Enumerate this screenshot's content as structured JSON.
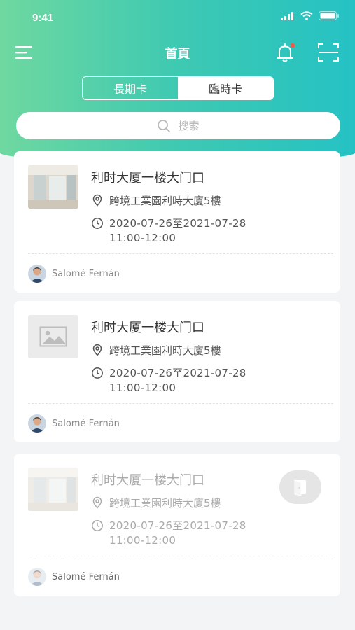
{
  "status": {
    "time": "9:41"
  },
  "nav": {
    "title": "首頁"
  },
  "tabs": [
    {
      "label": "長期卡",
      "active": false
    },
    {
      "label": "臨時卡",
      "active": true
    }
  ],
  "search": {
    "placeholder": "搜索"
  },
  "cards": [
    {
      "title": "利时大厦一楼大门口",
      "location": "跨境工業園利時大廈5樓",
      "date_range": "2020-07-26至2021-07-28",
      "time_range": "11:00-12:00",
      "user": "Salomé Fernán",
      "image": "office-photo",
      "state": "normal"
    },
    {
      "title": "利时大厦一楼大门口",
      "location": "跨境工業園利時大廈5樓",
      "date_range": "2020-07-26至2021-07-28",
      "time_range": "11:00-12:00",
      "user": "Salomé Fernán",
      "image": "image-placeholder",
      "state": "normal"
    },
    {
      "title": "利时大厦一楼大门口",
      "location": "跨境工業園利時大廈5樓",
      "date_range": "2020-07-26至2021-07-28",
      "time_range": "11:00-12:00",
      "user": "Salomé Fernán",
      "image": "office-photo",
      "state": "faded",
      "action_icon": "door-icon"
    }
  ],
  "colors": {
    "gradient_start": "#6fd8a0",
    "gradient_end": "#25c2c4",
    "notification_dot": "#f15a4a"
  }
}
